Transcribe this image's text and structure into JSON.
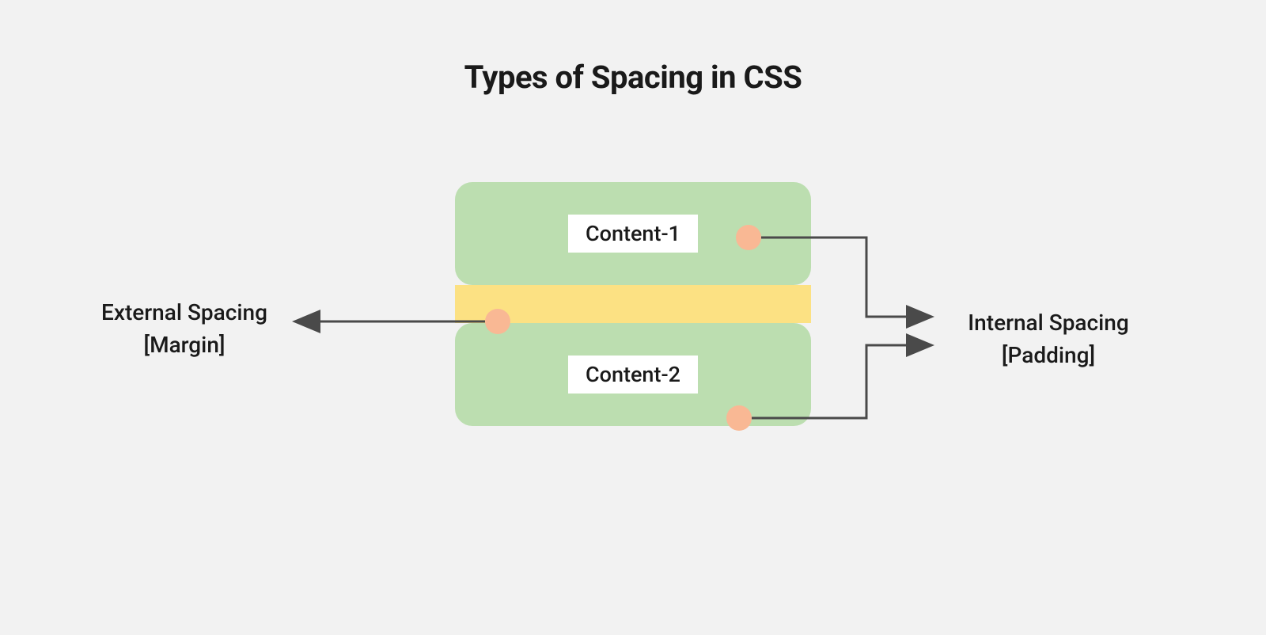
{
  "title": "Types of Spacing in CSS",
  "boxes": {
    "content1": "Content-1",
    "content2": "Content-2"
  },
  "labels": {
    "external_line1": "External Spacing",
    "external_line2": "[Margin]",
    "internal_line1": "Internal Spacing",
    "internal_line2": "[Padding]"
  },
  "colors": {
    "box_bg": "#bcdeb0",
    "margin_bg": "#fce183",
    "dot": "#f9b894",
    "arrow": "#4a4a4a",
    "page_bg": "#f2f2f2"
  }
}
